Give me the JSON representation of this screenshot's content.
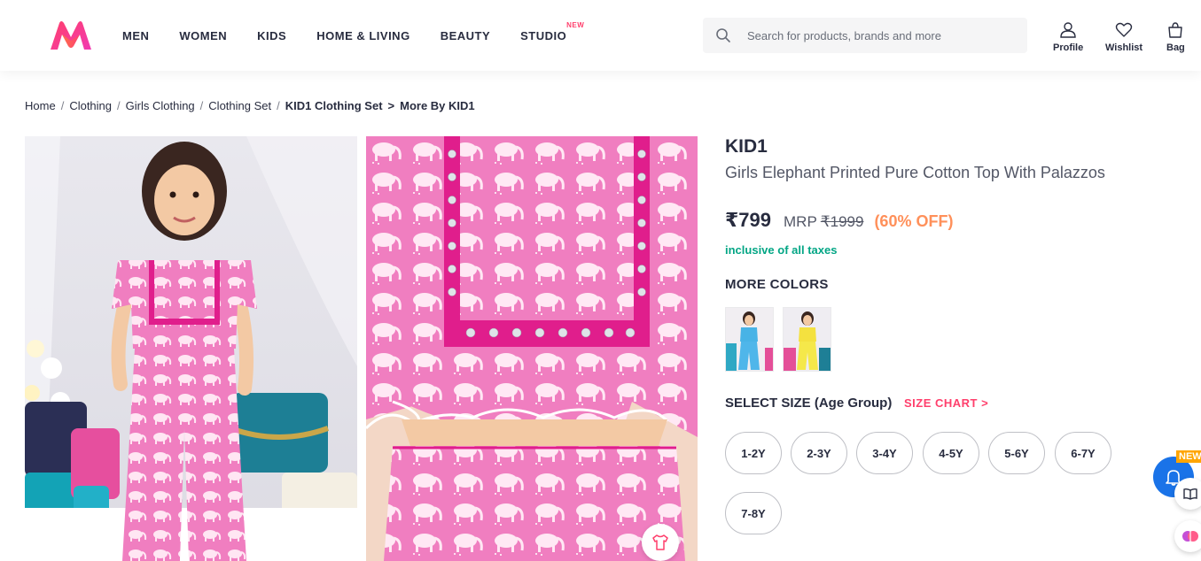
{
  "brand_colors": {
    "accent": "#ff3f6c",
    "discount": "#ff905a",
    "taxes": "#03a685"
  },
  "header": {
    "nav": [
      {
        "label": "MEN"
      },
      {
        "label": "WOMEN"
      },
      {
        "label": "KIDS"
      },
      {
        "label": "HOME & LIVING"
      },
      {
        "label": "BEAUTY"
      },
      {
        "label": "STUDIO",
        "tag": "NEW"
      }
    ],
    "search_placeholder": "Search for products, brands and more",
    "actions": {
      "profile": "Profile",
      "wishlist": "Wishlist",
      "bag": "Bag"
    }
  },
  "breadcrumb": {
    "items": [
      "Home",
      "Clothing",
      "Girls Clothing",
      "Clothing Set",
      "KID1 Clothing Set"
    ],
    "more": "More By KID1"
  },
  "product": {
    "brand": "KID1",
    "name": "Girls Elephant Printed Pure Cotton Top With Palazzos",
    "price": "₹799",
    "mrp_label": "MRP",
    "mrp": "₹1999",
    "discount": "(60% OFF)",
    "taxes": "inclusive of all taxes",
    "more_colors_title": "MORE COLORS",
    "select_size_title": "SELECT SIZE (Age Group)",
    "size_chart": "SIZE CHART",
    "sizes": [
      "1-2Y",
      "2-3Y",
      "3-4Y",
      "4-5Y",
      "5-6Y",
      "6-7Y",
      "7-8Y"
    ]
  },
  "widgets": {
    "new_badge": "NEW"
  }
}
